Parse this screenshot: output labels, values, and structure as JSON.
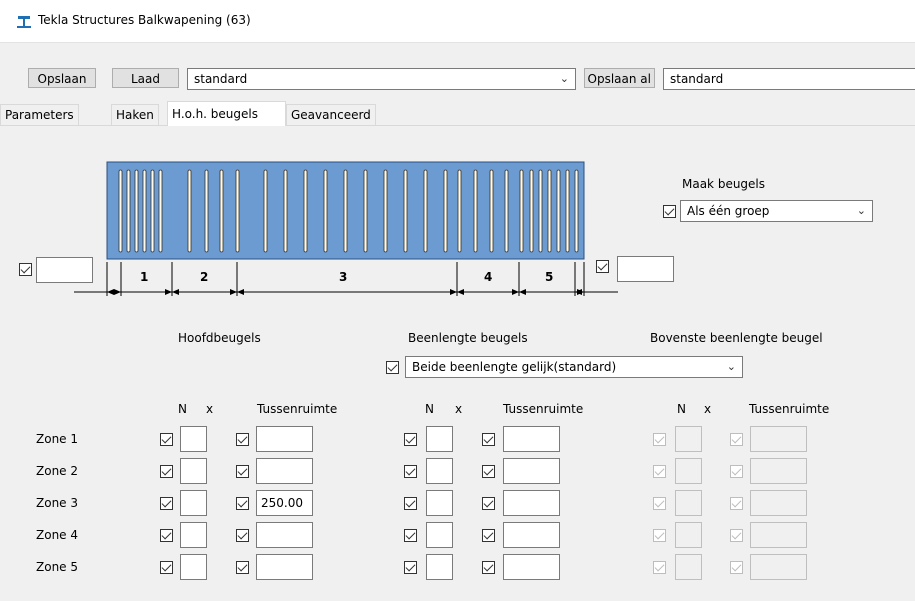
{
  "window": {
    "title": "Tekla Structures  Balkwapening (63)"
  },
  "toolbar": {
    "save_label": "Opslaan",
    "load_label": "Laad",
    "preset_value": "standard",
    "save_as_label": "Opslaan al",
    "save_as_value": "standard"
  },
  "tabs": [
    {
      "label": "Parameters"
    },
    {
      "label": "Haken"
    },
    {
      "label": "H.o.h. beugels"
    },
    {
      "label": "Geavanceerd"
    }
  ],
  "diagram": {
    "zone_labels": [
      "1",
      "2",
      "3",
      "4",
      "5"
    ]
  },
  "maak_beugels": {
    "label": "Maak beugels",
    "value": "Als één groep"
  },
  "groups": {
    "hoofdbeugels": "Hoofdbeugels",
    "beenlengte": "Beenlengte beugels",
    "bovenste": "Bovenste beenlengte beugel",
    "beenlengte_option": "Beide beenlengte gelijk(standard)"
  },
  "columns": {
    "n": "N",
    "x": "x",
    "tussenruimte": "Tussenruimte"
  },
  "zones": [
    {
      "label": "Zone 1",
      "h_n": "",
      "h_t": "",
      "b_n": "",
      "b_t": ""
    },
    {
      "label": "Zone 2",
      "h_n": "",
      "h_t": "",
      "b_n": "",
      "b_t": ""
    },
    {
      "label": "Zone 3",
      "h_n": "",
      "h_t": "250.00",
      "b_n": "",
      "b_t": ""
    },
    {
      "label": "Zone 4",
      "h_n": "",
      "h_t": "",
      "b_n": "",
      "b_t": ""
    },
    {
      "label": "Zone 5",
      "h_n": "",
      "h_t": "",
      "b_n": "",
      "b_t": ""
    }
  ],
  "colors": {
    "beam": "#6b9bd1",
    "accent": "#0078d7"
  }
}
